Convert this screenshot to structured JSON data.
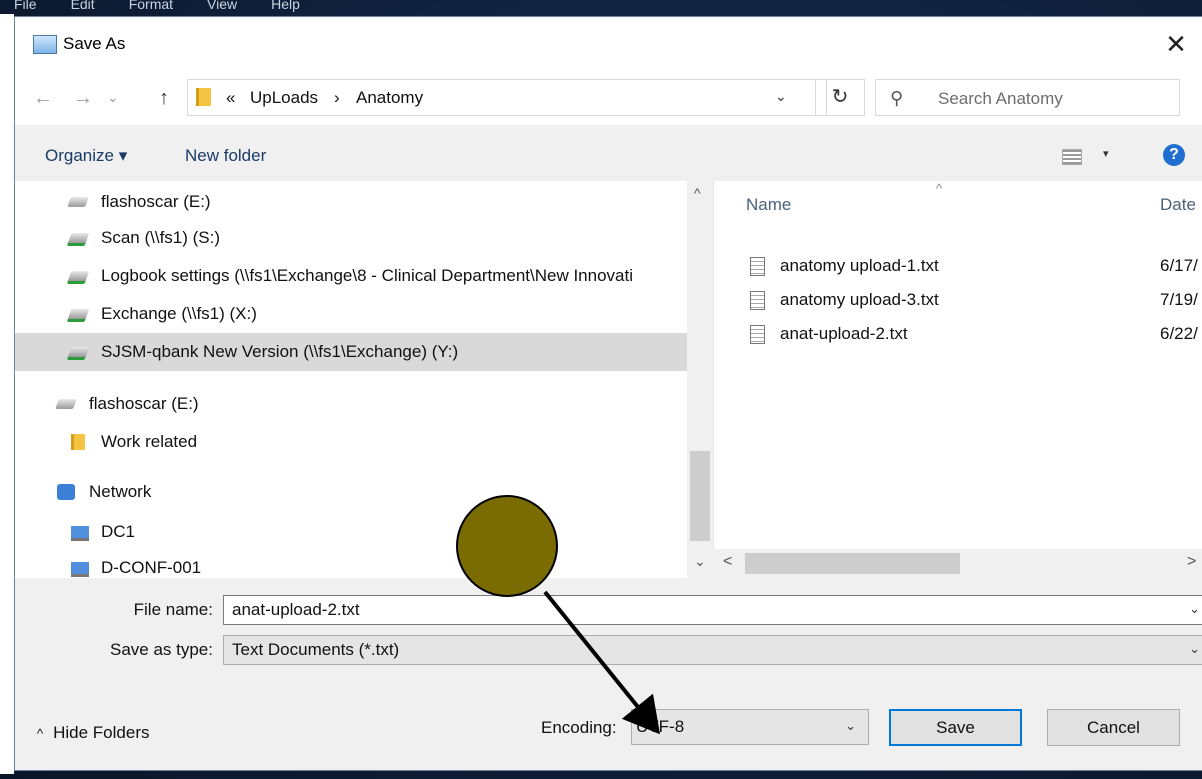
{
  "background_app": {
    "menubar": [
      "File",
      "Edit",
      "Format",
      "View",
      "Help"
    ]
  },
  "dialog": {
    "title": "Save As",
    "close_glyph": "✕",
    "nav": {
      "back": "←",
      "forward": "→",
      "recent": "⌄",
      "up": "↑"
    },
    "breadcrumb": {
      "overflow": "«",
      "items": [
        "UpLoads",
        "Anatomy"
      ],
      "separator": "›",
      "dropdown": "⌄"
    },
    "refresh_glyph": "↻",
    "search": {
      "placeholder": "Search Anatomy",
      "icon": "search-icon"
    },
    "toolbar": {
      "organize_label": "Organize ▾",
      "new_folder_label": "New folder",
      "view_dropdown": "▾",
      "help_label": "?"
    },
    "nav_tree": [
      {
        "label": "flashoscar (E:)",
        "icon": "drive"
      },
      {
        "label": "Scan (\\\\fs1) (S:)",
        "icon": "network-drive"
      },
      {
        "label": "Logbook settings (\\\\fs1\\Exchange\\8 - Clinical Department\\New Innovati",
        "icon": "network-drive"
      },
      {
        "label": "Exchange (\\\\fs1) (X:)",
        "icon": "network-drive"
      },
      {
        "label": "SJSM-qbank New Version (\\\\fs1\\Exchange) (Y:)",
        "icon": "network-drive",
        "selected": true
      },
      {
        "label": "flashoscar (E:)",
        "icon": "drive"
      },
      {
        "label": "Work related",
        "icon": "folder"
      },
      {
        "label": "Network",
        "icon": "network"
      },
      {
        "label": "DC1",
        "icon": "computer"
      },
      {
        "label": "D-CONF-001",
        "icon": "computer"
      }
    ],
    "scroll": {
      "up": "^",
      "down": "⌄",
      "left": "<",
      "right": ">"
    },
    "file_list": {
      "sort_indicator": "^",
      "columns": {
        "name": "Name",
        "date": "Date"
      },
      "rows": [
        {
          "name": "anatomy upload-1.txt",
          "date": "6/17/"
        },
        {
          "name": "anatomy upload-3.txt",
          "date": "7/19/"
        },
        {
          "name": "anat-upload-2.txt",
          "date": "6/22/"
        }
      ]
    },
    "form": {
      "file_name_label": "File name:",
      "file_name_value": "anat-upload-2.txt",
      "save_type_label": "Save as type:",
      "save_type_value": "Text Documents (*.txt)",
      "dropdown_glyph": "⌄"
    },
    "footer": {
      "hide_folders_caret": "^",
      "hide_folders_label": "Hide Folders",
      "encoding_label": "Encoding:",
      "encoding_value": "UTF-8",
      "save_label": "Save",
      "cancel_label": "Cancel"
    }
  },
  "annotation": {
    "circle_color": "#7a6c00",
    "arrow_color": "#000000"
  }
}
